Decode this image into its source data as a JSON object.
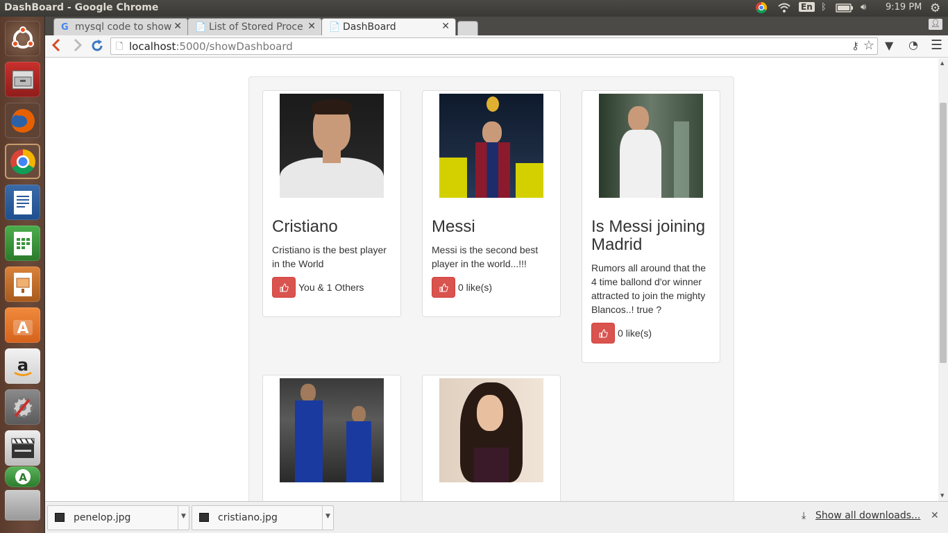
{
  "os": {
    "window_title": "DashBoard - Google Chrome",
    "keyboard": "En",
    "clock": "9:19 PM"
  },
  "launcher": {
    "apps": [
      "ubuntu-dash",
      "file-manager",
      "firefox",
      "chrome",
      "libreoffice-writer",
      "libreoffice-calc",
      "libreoffice-impress",
      "ubuntu-software-center",
      "amazon",
      "system-settings",
      "video-editor",
      "update-manager",
      "workspaces"
    ]
  },
  "browser": {
    "tabs": [
      {
        "label": "mysql code to show",
        "icon": "G"
      },
      {
        "label": "List of Stored Proce",
        "icon": "📄"
      },
      {
        "label": "DashBoard",
        "icon": "📄"
      }
    ],
    "url_host": "localhost",
    "url_rest": ":5000/showDashboard"
  },
  "dashboard": {
    "cards": [
      {
        "title": "Cristiano",
        "text": "Cristiano is the best player in the World",
        "likes": "You & 1 Others"
      },
      {
        "title": "Messi",
        "text": "Messi is the second best player in the world...!!!",
        "likes": "0 like(s)"
      },
      {
        "title": "Is Messi joining Madrid",
        "text": "Rumors all around that the 4 time ballond d'or winner attracted to join the mighty Blancos..! true ?",
        "likes": "0 like(s)"
      },
      {
        "title": "",
        "text": "",
        "likes": ""
      },
      {
        "title": "",
        "text": "",
        "likes": ""
      }
    ]
  },
  "downloads": {
    "items": [
      "penelop.jpg",
      "cristiano.jpg"
    ],
    "show_all": "Show all downloads..."
  },
  "colors": {
    "like_button": "#d9534f",
    "panel_bg": "#f5f5f5"
  }
}
